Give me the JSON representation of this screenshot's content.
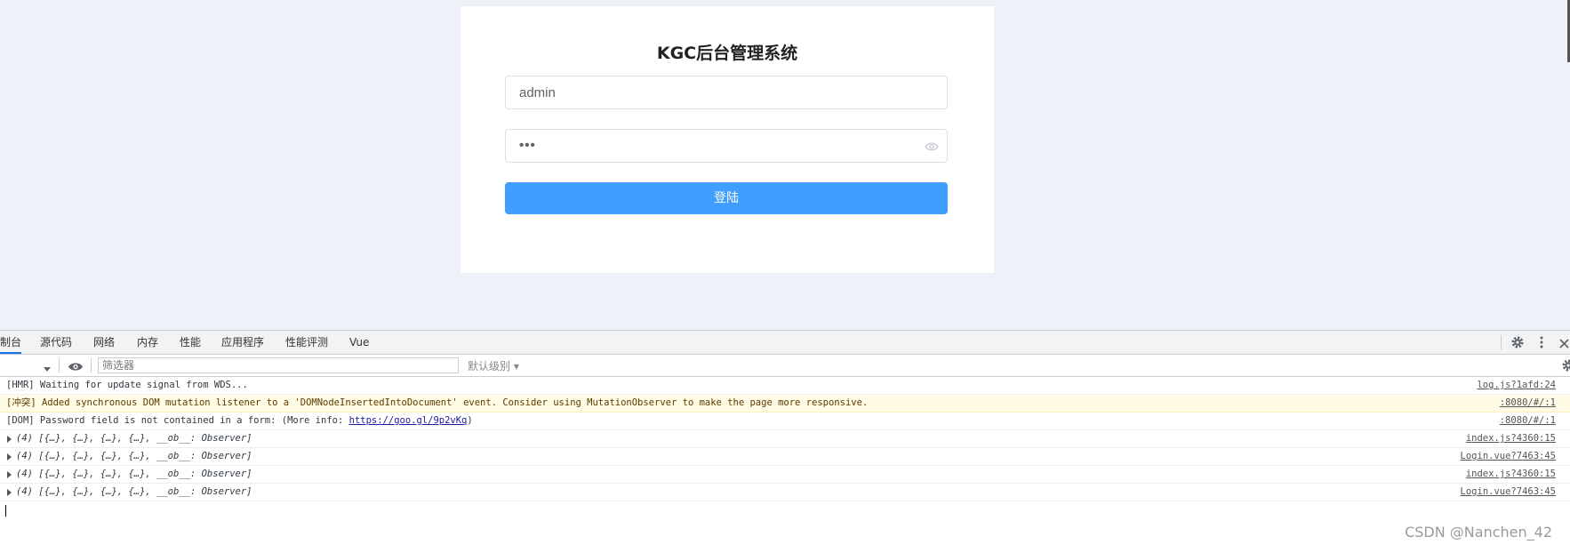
{
  "login": {
    "title": "KGC后台管理系统",
    "username_value": "admin",
    "password_value": "•••",
    "button_label": "登陆"
  },
  "devtools": {
    "tabs": [
      "制台",
      "源代码",
      "网络",
      "内存",
      "性能",
      "应用程序",
      "性能评测",
      "Vue"
    ],
    "filter_placeholder": "筛选器",
    "levels_label": "默认级别 ▾",
    "accent_color": "#1a73e8"
  },
  "console": {
    "messages": [
      {
        "text": "[HMR] Waiting for update signal from WDS...",
        "source": "log.js?1afd:24",
        "type": "log"
      },
      {
        "text": "[冲突] Added synchronous DOM mutation listener to a 'DOMNodeInsertedIntoDocument' event. Consider using MutationObserver to make the page more responsive.",
        "source": ":8080/#/:1",
        "type": "warning"
      },
      {
        "text_prefix": "[DOM] Password field is not contained in a form: (More info: ",
        "link": "https://goo.gl/9p2vKq",
        "text_suffix": ")",
        "source": ":8080/#/:1",
        "type": "log"
      },
      {
        "text": "(4) [{…}, {…}, {…}, {…}, __ob__: Observer]",
        "source": "index.js?4360:15",
        "type": "object"
      },
      {
        "text": "(4) [{…}, {…}, {…}, {…}, __ob__: Observer]",
        "source": "Login.vue?7463:45",
        "type": "object"
      },
      {
        "text": "(4) [{…}, {…}, {…}, {…}, __ob__: Observer]",
        "source": "index.js?4360:15",
        "type": "object"
      },
      {
        "text": "(4) [{…}, {…}, {…}, {…}, __ob__: Observer]",
        "source": "Login.vue?7463:45",
        "type": "object"
      }
    ]
  },
  "watermark": "CSDN @Nanchen_42",
  "colors": {
    "primary_button": "#409eff",
    "page_background": "#edf1f8",
    "warning_background": "#fffbe5"
  }
}
